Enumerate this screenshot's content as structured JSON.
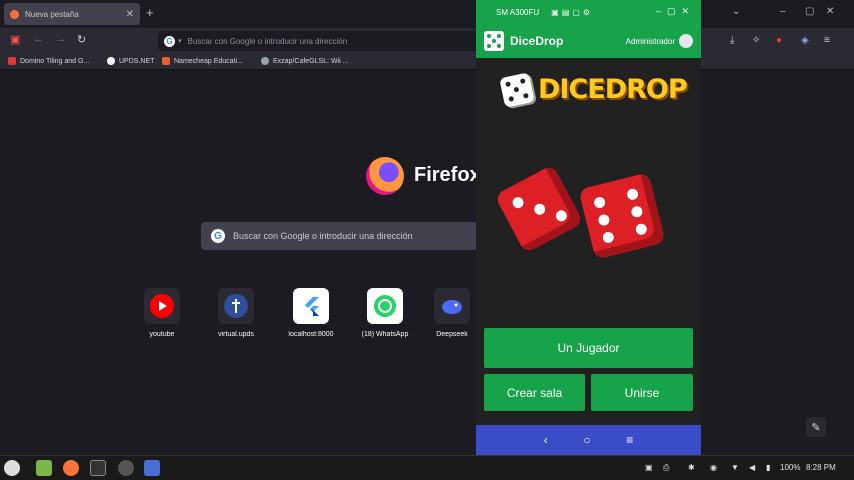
{
  "browser": {
    "tab_title": "Nueva pestaña",
    "url_placeholder": "Buscar con Google o introducir una dirección",
    "bookmarks": [
      {
        "label": "Domino Tiling and G...",
        "color": "#e03b3b"
      },
      {
        "label": "UPDS.NET",
        "color": "#ffffff"
      },
      {
        "label": "Namecheap Educati...",
        "color": "#e8622a"
      },
      {
        "label": "Exzap/CafeGLSL: Wii ...",
        "color": "#9ea3aa"
      }
    ],
    "brand": "Firefox",
    "search_placeholder": "Buscar con Google o introducir una dirección",
    "shortcuts": [
      {
        "label": "youtube",
        "icon": "youtube-icon",
        "color": "#ff0000"
      },
      {
        "label": "virtual.upds",
        "icon": "upds-icon",
        "color": "#2f4f9e"
      },
      {
        "label": "localhost:8000",
        "icon": "flutter-icon",
        "color": "#42a5f5"
      },
      {
        "label": "(18) WhatsApp",
        "icon": "whatsapp-icon",
        "color": "#25d366"
      },
      {
        "label": "Deepseek",
        "icon": "deepseek-icon",
        "color": "#4d6bfe"
      }
    ]
  },
  "phone": {
    "device_name": "SM A300FU",
    "app_name": "DiceDrop",
    "user_label": "Administrador",
    "logo_text": "DICEDROP",
    "buttons": {
      "single_player": "Un Jugador",
      "create_room": "Crear sala",
      "join": "Unirse"
    },
    "accent": "#16a34a",
    "nav_color": "#3b4cc9"
  },
  "taskbar": {
    "battery": "100%",
    "time": "8:28 PM"
  }
}
